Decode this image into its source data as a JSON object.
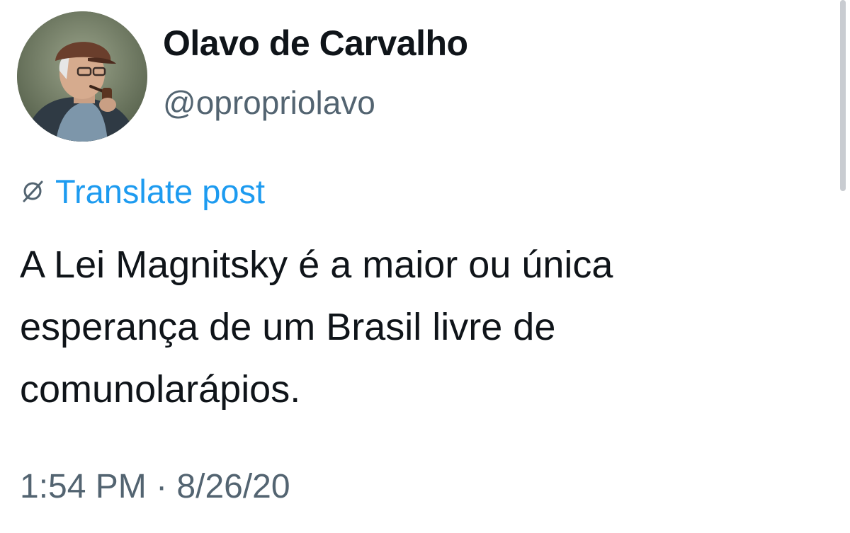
{
  "author": {
    "display_name": "Olavo de Carvalho",
    "handle": "@opropriolavo",
    "avatar_icon": "profile-photo"
  },
  "translate": {
    "icon": "globe-slash-icon",
    "label": "Translate post",
    "color": "#1d9bf0"
  },
  "post": {
    "lines": [
      "A Lei Magnitsky é a maior ou única",
      "esperança de um Brasil livre de",
      "comunolarápios."
    ]
  },
  "meta": {
    "timestamp": "1:54 PM · 8/26/20"
  }
}
